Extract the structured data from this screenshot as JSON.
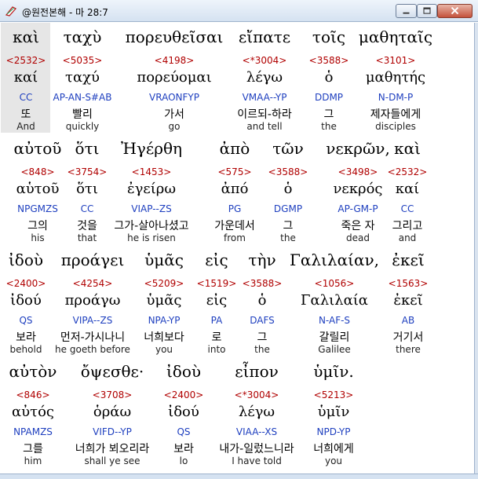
{
  "window": {
    "title": "@원전본해 - 마 28:7",
    "app_icon": "bible-tool-icon"
  },
  "lines": [
    {
      "words": [
        {
          "greek": "καὶ",
          "strong": "<2532>",
          "lemma": "καί",
          "parse": "CC",
          "korean": "또",
          "english": "And"
        },
        {
          "greek": "ταχὺ",
          "strong": "<5035>",
          "lemma": "ταχύ",
          "parse": "AP-AN-S#AB",
          "korean": "빨리",
          "english": "quickly"
        },
        {
          "greek": "πορευθεῖσαι",
          "strong": "<4198>",
          "lemma": "πορεύομαι",
          "parse": "VRAONFYP",
          "korean": "가서",
          "english": "go"
        },
        {
          "greek": "εἴπατε",
          "strong": "<*3004>",
          "lemma": "λέγω",
          "parse": "VMAA--YP",
          "korean": "이르되-하라",
          "english": "and tell"
        },
        {
          "greek": "τοῖς",
          "strong": "<3588>",
          "lemma": "ὁ",
          "parse": "DDMP",
          "korean": "그",
          "english": "the"
        },
        {
          "greek": "μαθηταῖς",
          "strong": "<3101>",
          "lemma": "μαθητής",
          "parse": "N-DM-P",
          "korean": "제자들에게",
          "english": "disciples"
        }
      ]
    },
    {
      "words": [
        {
          "greek": "αὐτοῦ",
          "strong": "<848>",
          "lemma": "αὑτοῦ",
          "parse": "NPGMZS",
          "korean": "그의",
          "english": "his"
        },
        {
          "greek": "ὅτι",
          "strong": "<3754>",
          "lemma": "ὅτι",
          "parse": "CC",
          "korean": "것을",
          "english": "that"
        },
        {
          "greek": "Ἠγέρθη",
          "strong": "<1453>",
          "lemma": "ἐγείρω",
          "parse": "VIAP--ZS",
          "korean": "그가-살아나셨고",
          "english": "he is risen"
        },
        {
          "greek": "ἀπὸ",
          "strong": "<575>",
          "lemma": "ἀπό",
          "parse": "PG",
          "korean": "가운데서",
          "english": "from"
        },
        {
          "greek": "τῶν",
          "strong": "<3588>",
          "lemma": "ὁ",
          "parse": "DGMP",
          "korean": "그",
          "english": "the"
        },
        {
          "greek": "νεκρῶν,",
          "strong": "<3498>",
          "lemma": "νεκρός",
          "parse": "AP-GM-P",
          "korean": "죽은 자",
          "english": "dead"
        },
        {
          "greek": "καὶ",
          "strong": "<2532>",
          "lemma": "καί",
          "parse": "CC",
          "korean": "그리고",
          "english": "and"
        }
      ]
    },
    {
      "words": [
        {
          "greek": "ἰδοὺ",
          "strong": "<2400>",
          "lemma": "ἰδού",
          "parse": "QS",
          "korean": "보라",
          "english": "behold"
        },
        {
          "greek": "προάγει",
          "strong": "<4254>",
          "lemma": "προάγω",
          "parse": "VIPA--ZS",
          "korean": "먼저-가시나니",
          "english": "he goeth before"
        },
        {
          "greek": "ὑμᾶς",
          "strong": "<5209>",
          "lemma": "ὑμᾶς",
          "parse": "NPA-YP",
          "korean": "너희보다",
          "english": "you"
        },
        {
          "greek": "εἰς",
          "strong": "<1519>",
          "lemma": "εἰς",
          "parse": "PA",
          "korean": "로",
          "english": "into"
        },
        {
          "greek": "τὴν",
          "strong": "<3588>",
          "lemma": "ὁ",
          "parse": "DAFS",
          "korean": "그",
          "english": "the"
        },
        {
          "greek": "Γαλιλαίαν,",
          "strong": "<1056>",
          "lemma": "Γαλιλαία",
          "parse": "N-AF-S",
          "korean": "갈릴리",
          "english": "Galilee"
        },
        {
          "greek": "ἐκεῖ",
          "strong": "<1563>",
          "lemma": "ἐκεῖ",
          "parse": "AB",
          "korean": "거기서",
          "english": "there"
        }
      ]
    },
    {
      "words": [
        {
          "greek": "αὐτὸν",
          "strong": "<846>",
          "lemma": "αὐτός",
          "parse": "NPAMZS",
          "korean": "그를",
          "english": "him"
        },
        {
          "greek": "ὄψεσθε·",
          "strong": "<3708>",
          "lemma": "ὁράω",
          "parse": "VIFD--YP",
          "korean": "너희가 뵈오리라",
          "english": "shall ye see"
        },
        {
          "greek": "ἰδοὺ",
          "strong": "<2400>",
          "lemma": "ἰδού",
          "parse": "QS",
          "korean": "보라",
          "english": "lo"
        },
        {
          "greek": "εἶπον",
          "strong": "<*3004>",
          "lemma": "λέγω",
          "parse": "VIAA--XS",
          "korean": "내가-일렀느니라",
          "english": "I have told"
        },
        {
          "greek": "ὑμῖν.",
          "strong": "<5213>",
          "lemma": "ὑμῖν",
          "parse": "NPD-YP",
          "korean": "너희에게",
          "english": "you"
        }
      ]
    }
  ]
}
